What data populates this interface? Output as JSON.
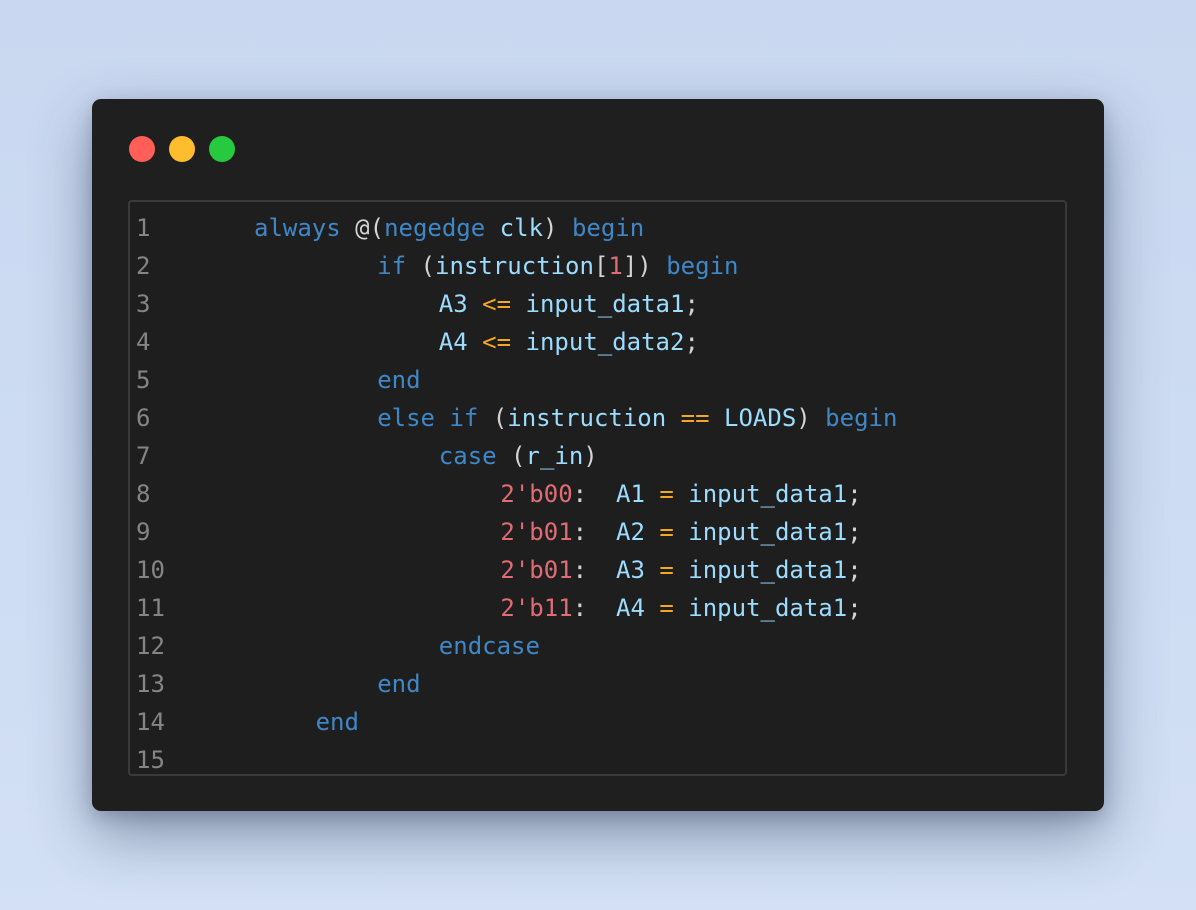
{
  "window": {
    "controls": [
      {
        "name": "close",
        "color": "#ff5f56"
      },
      {
        "name": "minimize",
        "color": "#ffbd2e"
      },
      {
        "name": "maximize",
        "color": "#27c93f"
      }
    ]
  },
  "editor": {
    "lines": [
      {
        "number": "1",
        "indent": 0,
        "tokens": [
          {
            "t": "always",
            "k": "keyword"
          },
          {
            "t": " ",
            "k": "punct"
          },
          {
            "t": "@(",
            "k": "punct"
          },
          {
            "t": "negedge",
            "k": "keyword"
          },
          {
            "t": " ",
            "k": "punct"
          },
          {
            "t": "clk",
            "k": "ident"
          },
          {
            "t": ") ",
            "k": "punct"
          },
          {
            "t": "begin",
            "k": "keyword"
          }
        ]
      },
      {
        "number": "2",
        "indent": 4,
        "tokens": [
          {
            "t": "if",
            "k": "keyword"
          },
          {
            "t": " (",
            "k": "punct"
          },
          {
            "t": "instruction",
            "k": "ident"
          },
          {
            "t": "[",
            "k": "punct"
          },
          {
            "t": "1",
            "k": "number"
          },
          {
            "t": "]) ",
            "k": "punct"
          },
          {
            "t": "begin",
            "k": "keyword"
          }
        ]
      },
      {
        "number": "3",
        "indent": 6,
        "tokens": [
          {
            "t": "A3",
            "k": "ident"
          },
          {
            "t": " ",
            "k": "punct"
          },
          {
            "t": "<=",
            "k": "op"
          },
          {
            "t": " ",
            "k": "punct"
          },
          {
            "t": "input_data1",
            "k": "ident"
          },
          {
            "t": ";",
            "k": "punct"
          }
        ]
      },
      {
        "number": "4",
        "indent": 6,
        "tokens": [
          {
            "t": "A4",
            "k": "ident"
          },
          {
            "t": " ",
            "k": "punct"
          },
          {
            "t": "<=",
            "k": "op"
          },
          {
            "t": " ",
            "k": "punct"
          },
          {
            "t": "input_data2",
            "k": "ident"
          },
          {
            "t": ";",
            "k": "punct"
          }
        ]
      },
      {
        "number": "5",
        "indent": 4,
        "tokens": [
          {
            "t": "end",
            "k": "keyword"
          }
        ]
      },
      {
        "number": "6",
        "indent": 4,
        "tokens": [
          {
            "t": "else",
            "k": "keyword"
          },
          {
            "t": " ",
            "k": "punct"
          },
          {
            "t": "if",
            "k": "keyword"
          },
          {
            "t": " (",
            "k": "punct"
          },
          {
            "t": "instruction",
            "k": "ident"
          },
          {
            "t": " ",
            "k": "punct"
          },
          {
            "t": "==",
            "k": "op"
          },
          {
            "t": " ",
            "k": "punct"
          },
          {
            "t": "LOADS",
            "k": "ident"
          },
          {
            "t": ") ",
            "k": "punct"
          },
          {
            "t": "begin",
            "k": "keyword"
          }
        ]
      },
      {
        "number": "7",
        "indent": 6,
        "tokens": [
          {
            "t": "case",
            "k": "keyword"
          },
          {
            "t": " (",
            "k": "punct"
          },
          {
            "t": "r_in",
            "k": "ident"
          },
          {
            "t": ")",
            "k": "punct"
          }
        ]
      },
      {
        "number": "8",
        "indent": 8,
        "tokens": [
          {
            "t": "2'b00",
            "k": "number"
          },
          {
            "t": ":  ",
            "k": "punct"
          },
          {
            "t": "A1",
            "k": "ident"
          },
          {
            "t": " ",
            "k": "punct"
          },
          {
            "t": "=",
            "k": "op"
          },
          {
            "t": " ",
            "k": "punct"
          },
          {
            "t": "input_data1",
            "k": "ident"
          },
          {
            "t": ";",
            "k": "punct"
          }
        ]
      },
      {
        "number": "9",
        "indent": 8,
        "tokens": [
          {
            "t": "2'b01",
            "k": "number"
          },
          {
            "t": ":  ",
            "k": "punct"
          },
          {
            "t": "A2",
            "k": "ident"
          },
          {
            "t": " ",
            "k": "punct"
          },
          {
            "t": "=",
            "k": "op"
          },
          {
            "t": " ",
            "k": "punct"
          },
          {
            "t": "input_data1",
            "k": "ident"
          },
          {
            "t": ";",
            "k": "punct"
          }
        ]
      },
      {
        "number": "10",
        "indent": 8,
        "tokens": [
          {
            "t": "2'b01",
            "k": "number"
          },
          {
            "t": ":  ",
            "k": "punct"
          },
          {
            "t": "A3",
            "k": "ident"
          },
          {
            "t": " ",
            "k": "punct"
          },
          {
            "t": "=",
            "k": "op"
          },
          {
            "t": " ",
            "k": "punct"
          },
          {
            "t": "input_data1",
            "k": "ident"
          },
          {
            "t": ";",
            "k": "punct"
          }
        ]
      },
      {
        "number": "11",
        "indent": 8,
        "tokens": [
          {
            "t": "2'b11",
            "k": "number"
          },
          {
            "t": ":  ",
            "k": "punct"
          },
          {
            "t": "A4",
            "k": "ident"
          },
          {
            "t": " ",
            "k": "punct"
          },
          {
            "t": "=",
            "k": "op"
          },
          {
            "t": " ",
            "k": "punct"
          },
          {
            "t": "input_data1",
            "k": "ident"
          },
          {
            "t": ";",
            "k": "punct"
          }
        ]
      },
      {
        "number": "12",
        "indent": 6,
        "tokens": [
          {
            "t": "endcase",
            "k": "keyword"
          }
        ]
      },
      {
        "number": "13",
        "indent": 4,
        "tokens": [
          {
            "t": "end",
            "k": "keyword"
          }
        ]
      },
      {
        "number": "14",
        "indent": 2,
        "tokens": [
          {
            "t": "end",
            "k": "keyword"
          }
        ]
      },
      {
        "number": "15",
        "indent": 0,
        "tokens": []
      }
    ]
  }
}
